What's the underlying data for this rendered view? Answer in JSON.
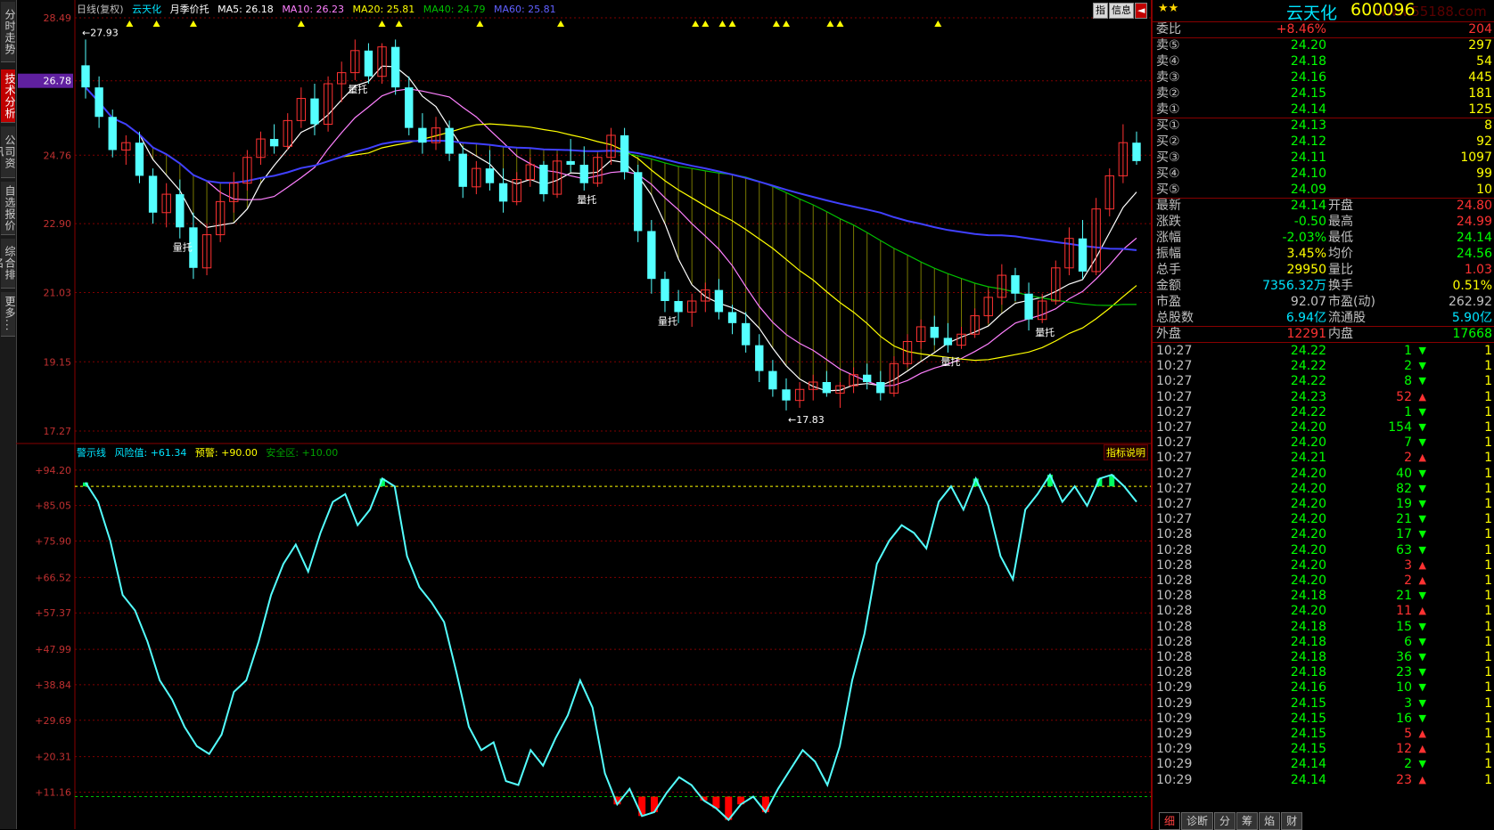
{
  "sidebar": {
    "tabs": [
      {
        "label": "分时走势",
        "active": false
      },
      {
        "label": "技术分析",
        "active": true
      },
      {
        "label": "公司资讯",
        "active": false
      },
      {
        "label": "自选报价",
        "active": false
      },
      {
        "label": "综合排名",
        "active": false
      },
      {
        "label": "更多...",
        "active": false
      }
    ]
  },
  "top_legend": {
    "period": "日线(复权)",
    "stock": "云天化",
    "indicator": "月季价托",
    "ma5": "MA5: 26.18",
    "ma10": "MA10: 26.23",
    "ma20": "MA20: 25.81",
    "ma40": "MA40: 24.79",
    "ma60": "MA60: 25.81"
  },
  "top_buttons": [
    "指",
    "信息",
    "◄"
  ],
  "lower_legend": {
    "name": "警示线",
    "risk": "风险值: +61.34",
    "warn": "预警: +90.00",
    "safe": "安全区: +10.00",
    "explain": "指标说明"
  },
  "colors": {
    "up": "#ff3232",
    "down": "#54ffff",
    "ma5": "#ffffff",
    "ma10": "#ff80ff",
    "ma20": "#ffff00",
    "ma40": "#00c000",
    "ma60": "#4040ff",
    "grid": "#800000",
    "osc": "#54ffff"
  },
  "chart_data": [
    {
      "type": "candlestick",
      "title": "日线(复权)",
      "ylabels": [
        "28.49",
        "26.78",
        "24.76",
        "22.90",
        "21.03",
        "19.15",
        "17.27"
      ],
      "current_price_label": "26.78",
      "ylim": [
        17.27,
        28.49
      ],
      "annotations": {
        "high": "←27.93",
        "low": "←17.83",
        "volume_support": "量托"
      },
      "signal_markers": 17,
      "ohlc": [
        [
          27.2,
          27.9,
          26.3,
          26.6
        ],
        [
          26.6,
          26.9,
          25.5,
          25.8
        ],
        [
          25.8,
          26.0,
          24.7,
          24.9
        ],
        [
          24.9,
          25.3,
          24.5,
          25.1
        ],
        [
          25.1,
          25.4,
          24.0,
          24.2
        ],
        [
          24.2,
          24.4,
          22.9,
          23.2
        ],
        [
          23.2,
          24.0,
          22.8,
          23.7
        ],
        [
          23.7,
          24.1,
          22.5,
          22.8
        ],
        [
          22.8,
          23.2,
          21.4,
          21.7
        ],
        [
          21.7,
          22.9,
          21.5,
          22.6
        ],
        [
          22.6,
          23.8,
          22.4,
          23.5
        ],
        [
          23.5,
          24.3,
          23.2,
          24.0
        ],
        [
          24.0,
          24.9,
          23.8,
          24.7
        ],
        [
          24.7,
          25.4,
          24.5,
          25.2
        ],
        [
          25.2,
          25.6,
          24.8,
          25.0
        ],
        [
          25.0,
          25.9,
          24.9,
          25.7
        ],
        [
          25.7,
          26.6,
          25.5,
          26.3
        ],
        [
          26.3,
          26.7,
          25.3,
          25.6
        ],
        [
          25.6,
          26.9,
          25.4,
          26.7
        ],
        [
          26.7,
          27.3,
          26.2,
          27.0
        ],
        [
          27.0,
          27.9,
          26.8,
          27.6
        ],
        [
          27.6,
          27.8,
          26.7,
          26.9
        ],
        [
          26.9,
          27.8,
          26.7,
          27.7
        ],
        [
          27.7,
          27.9,
          26.4,
          26.6
        ],
        [
          26.6,
          26.9,
          25.3,
          25.5
        ],
        [
          25.5,
          25.9,
          24.8,
          25.1
        ],
        [
          25.1,
          25.8,
          24.9,
          25.5
        ],
        [
          25.5,
          25.7,
          24.6,
          24.8
        ],
        [
          24.8,
          25.0,
          23.6,
          23.9
        ],
        [
          23.9,
          24.6,
          23.7,
          24.4
        ],
        [
          24.4,
          24.9,
          23.8,
          24.0
        ],
        [
          24.0,
          24.4,
          23.2,
          23.5
        ],
        [
          23.5,
          24.3,
          23.4,
          24.1
        ],
        [
          24.1,
          24.7,
          23.9,
          24.5
        ],
        [
          24.5,
          24.6,
          23.5,
          23.7
        ],
        [
          23.7,
          24.8,
          23.6,
          24.6
        ],
        [
          24.6,
          25.2,
          24.3,
          24.5
        ],
        [
          24.5,
          25.0,
          23.8,
          24.0
        ],
        [
          24.0,
          24.8,
          23.9,
          24.7
        ],
        [
          24.7,
          25.5,
          24.5,
          25.3
        ],
        [
          25.3,
          25.5,
          24.1,
          24.3
        ],
        [
          24.3,
          24.5,
          22.4,
          22.7
        ],
        [
          22.7,
          23.0,
          21.0,
          21.4
        ],
        [
          21.4,
          21.6,
          20.5,
          20.8
        ],
        [
          20.8,
          21.1,
          20.2,
          20.5
        ],
        [
          20.5,
          21.0,
          20.1,
          20.8
        ],
        [
          20.8,
          21.3,
          20.5,
          21.1
        ],
        [
          21.1,
          21.4,
          20.3,
          20.5
        ],
        [
          20.5,
          20.7,
          19.9,
          20.2
        ],
        [
          20.2,
          20.5,
          19.4,
          19.6
        ],
        [
          19.6,
          19.9,
          18.6,
          18.9
        ],
        [
          18.9,
          19.2,
          18.2,
          18.4
        ],
        [
          18.4,
          18.7,
          17.83,
          18.1
        ],
        [
          18.1,
          18.6,
          17.9,
          18.4
        ],
        [
          18.4,
          18.8,
          18.1,
          18.6
        ],
        [
          18.6,
          18.9,
          18.2,
          18.3
        ],
        [
          18.3,
          18.6,
          17.9,
          18.5
        ],
        [
          18.5,
          19.0,
          18.3,
          18.8
        ],
        [
          18.8,
          19.1,
          18.4,
          18.6
        ],
        [
          18.6,
          18.9,
          18.1,
          18.3
        ],
        [
          18.3,
          19.3,
          18.2,
          19.1
        ],
        [
          19.1,
          19.9,
          19.0,
          19.7
        ],
        [
          19.7,
          20.3,
          19.5,
          20.1
        ],
        [
          20.1,
          20.4,
          19.6,
          19.8
        ],
        [
          19.8,
          20.2,
          19.4,
          19.6
        ],
        [
          19.6,
          20.1,
          19.5,
          19.9
        ],
        [
          19.9,
          20.6,
          19.8,
          20.4
        ],
        [
          20.4,
          21.1,
          20.2,
          20.9
        ],
        [
          20.9,
          21.8,
          20.7,
          21.5
        ],
        [
          21.5,
          21.7,
          20.8,
          21.0
        ],
        [
          21.0,
          21.3,
          20.0,
          20.3
        ],
        [
          20.3,
          21.0,
          20.2,
          20.8
        ],
        [
          20.8,
          21.9,
          20.7,
          21.7
        ],
        [
          21.7,
          22.8,
          21.5,
          22.5
        ],
        [
          22.5,
          23.0,
          21.4,
          21.6
        ],
        [
          21.6,
          23.6,
          21.5,
          23.3
        ],
        [
          23.3,
          24.4,
          23.1,
          24.2
        ],
        [
          24.2,
          25.6,
          24.0,
          25.1
        ],
        [
          25.1,
          25.4,
          24.5,
          24.6
        ]
      ]
    },
    {
      "type": "line",
      "title": "警示线",
      "ylabels": [
        "+94.20",
        "+85.05",
        "+75.90",
        "+66.52",
        "+57.37",
        "+47.99",
        "+38.84",
        "+29.69",
        "+20.31",
        "+11.16"
      ],
      "ylim": [
        3.0,
        96.0
      ],
      "thresholds": {
        "warn": 90.0,
        "safe": 10.0
      },
      "values": [
        91,
        86,
        76,
        62,
        58,
        50,
        40,
        35,
        28,
        23,
        21,
        26,
        37,
        40,
        50,
        62,
        70,
        75,
        68,
        78,
        86,
        88,
        80,
        84,
        92,
        90,
        72,
        64,
        60,
        55,
        42,
        28,
        22,
        24,
        14,
        13,
        22,
        18,
        25,
        31,
        40,
        33,
        16,
        8,
        12,
        5,
        6,
        11,
        15,
        13,
        9,
        7,
        4,
        8,
        10,
        6,
        12,
        17,
        22,
        19,
        13,
        23,
        40,
        52,
        70,
        76,
        80,
        78,
        74,
        86,
        90,
        84,
        92,
        85,
        72,
        66,
        84,
        88,
        93,
        86,
        90,
        85,
        92,
        93,
        90,
        86
      ]
    }
  ],
  "quote": {
    "stars": "★★",
    "name": "云天化",
    "code": "600096",
    "watermark": "www.55188.com",
    "weibi_label": "委比",
    "weibi": "+8.46%",
    "weicha": "204",
    "sells": [
      {
        "label": "卖⑤",
        "price": "24.20",
        "vol": "297"
      },
      {
        "label": "卖④",
        "price": "24.18",
        "vol": "54"
      },
      {
        "label": "卖③",
        "price": "24.16",
        "vol": "445"
      },
      {
        "label": "卖②",
        "price": "24.15",
        "vol": "181"
      },
      {
        "label": "卖①",
        "price": "24.14",
        "vol": "125"
      }
    ],
    "buys": [
      {
        "label": "买①",
        "price": "24.13",
        "vol": "8"
      },
      {
        "label": "买②",
        "price": "24.12",
        "vol": "92"
      },
      {
        "label": "买③",
        "price": "24.11",
        "vol": "1097"
      },
      {
        "label": "买④",
        "price": "24.10",
        "vol": "99"
      },
      {
        "label": "买⑤",
        "price": "24.09",
        "vol": "10"
      }
    ],
    "stats": [
      {
        "l1": "最新",
        "v1": "24.14",
        "c1": "#00ff00",
        "l2": "开盘",
        "v2": "24.80",
        "c2": "#ff3232"
      },
      {
        "l1": "涨跌",
        "v1": "-0.50",
        "c1": "#00ff00",
        "l2": "最高",
        "v2": "24.99",
        "c2": "#ff3232"
      },
      {
        "l1": "涨幅",
        "v1": "-2.03%",
        "c1": "#00ff00",
        "l2": "最低",
        "v2": "24.14",
        "c2": "#00ff00"
      },
      {
        "l1": "振幅",
        "v1": "3.45%",
        "c1": "#ffff00",
        "l2": "均价",
        "v2": "24.56",
        "c2": "#00ff00"
      },
      {
        "l1": "总手",
        "v1": "29950",
        "c1": "#ffff00",
        "l2": "量比",
        "v2": "1.03",
        "c2": "#ff3232"
      },
      {
        "l1": "金额",
        "v1": "7356.32万",
        "c1": "#00e5ff",
        "l2": "换手",
        "v2": "0.51%",
        "c2": "#ffff00"
      },
      {
        "l1": "市盈",
        "v1": "92.07",
        "c1": "#c0c0c0",
        "l2": "市盈(动)",
        "v2": "262.92",
        "c2": "#c0c0c0"
      },
      {
        "l1": "总股数",
        "v1": "6.94亿",
        "c1": "#00e5ff",
        "l2": "流通股",
        "v2": "5.90亿",
        "c2": "#00e5ff"
      },
      {
        "l1": "外盘",
        "v1": "12291",
        "c1": "#ff3232",
        "l2": "内盘",
        "v2": "17668",
        "c2": "#00ff00"
      }
    ],
    "ticks": [
      {
        "t": "10:27",
        "p": "24.22",
        "v": "1",
        "d": "down",
        "n": "1"
      },
      {
        "t": "10:27",
        "p": "24.22",
        "v": "2",
        "d": "down",
        "n": "1"
      },
      {
        "t": "10:27",
        "p": "24.22",
        "v": "8",
        "d": "down",
        "n": "1"
      },
      {
        "t": "10:27",
        "p": "24.23",
        "v": "52",
        "d": "up",
        "n": "1"
      },
      {
        "t": "10:27",
        "p": "24.22",
        "v": "1",
        "d": "down",
        "n": "1"
      },
      {
        "t": "10:27",
        "p": "24.20",
        "v": "154",
        "d": "down",
        "n": "1"
      },
      {
        "t": "10:27",
        "p": "24.20",
        "v": "7",
        "d": "down",
        "n": "1"
      },
      {
        "t": "10:27",
        "p": "24.21",
        "v": "2",
        "d": "up",
        "n": "1"
      },
      {
        "t": "10:27",
        "p": "24.20",
        "v": "40",
        "d": "down",
        "n": "1"
      },
      {
        "t": "10:27",
        "p": "24.20",
        "v": "82",
        "d": "down",
        "n": "1"
      },
      {
        "t": "10:27",
        "p": "24.20",
        "v": "19",
        "d": "down",
        "n": "1"
      },
      {
        "t": "10:27",
        "p": "24.20",
        "v": "21",
        "d": "down",
        "n": "1"
      },
      {
        "t": "10:28",
        "p": "24.20",
        "v": "17",
        "d": "down",
        "n": "1"
      },
      {
        "t": "10:28",
        "p": "24.20",
        "v": "63",
        "d": "down",
        "n": "1"
      },
      {
        "t": "10:28",
        "p": "24.20",
        "v": "3",
        "d": "up",
        "n": "1"
      },
      {
        "t": "10:28",
        "p": "24.20",
        "v": "2",
        "d": "up",
        "n": "1"
      },
      {
        "t": "10:28",
        "p": "24.18",
        "v": "21",
        "d": "down",
        "n": "1"
      },
      {
        "t": "10:28",
        "p": "24.20",
        "v": "11",
        "d": "up",
        "n": "1"
      },
      {
        "t": "10:28",
        "p": "24.18",
        "v": "15",
        "d": "down",
        "n": "1"
      },
      {
        "t": "10:28",
        "p": "24.18",
        "v": "6",
        "d": "down",
        "n": "1"
      },
      {
        "t": "10:28",
        "p": "24.18",
        "v": "36",
        "d": "down",
        "n": "1"
      },
      {
        "t": "10:28",
        "p": "24.18",
        "v": "23",
        "d": "down",
        "n": "1"
      },
      {
        "t": "10:29",
        "p": "24.16",
        "v": "10",
        "d": "down",
        "n": "1"
      },
      {
        "t": "10:29",
        "p": "24.15",
        "v": "3",
        "d": "down",
        "n": "1"
      },
      {
        "t": "10:29",
        "p": "24.15",
        "v": "16",
        "d": "down",
        "n": "1"
      },
      {
        "t": "10:29",
        "p": "24.15",
        "v": "5",
        "d": "up",
        "n": "1"
      },
      {
        "t": "10:29",
        "p": "24.15",
        "v": "12",
        "d": "up",
        "n": "1"
      },
      {
        "t": "10:29",
        "p": "24.14",
        "v": "2",
        "d": "down",
        "n": "1"
      },
      {
        "t": "10:29",
        "p": "24.14",
        "v": "23",
        "d": "up",
        "n": "1"
      }
    ]
  },
  "bottom_tabs": [
    "细",
    "诊断",
    "分",
    "筹",
    "焰",
    "财"
  ]
}
